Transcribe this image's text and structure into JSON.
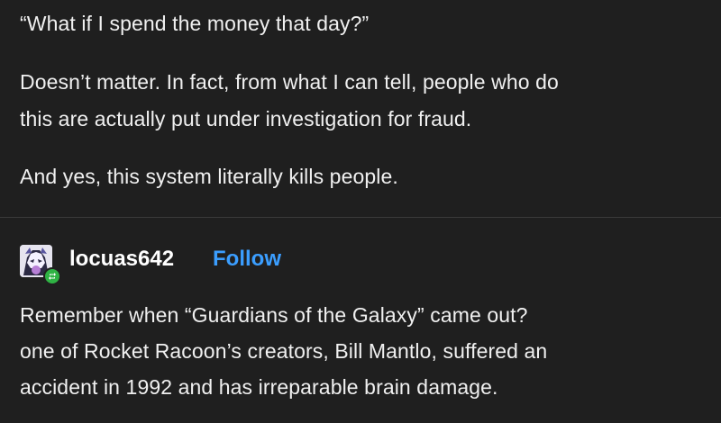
{
  "post_top": {
    "paragraphs": [
      "“What if I spend the money that day?”",
      "Doesn’t matter. In fact, from what I can tell, people who do",
      "this are actually put under investigation for fraud.",
      "And yes, this system literally kills people."
    ]
  },
  "reblog": {
    "username": "locuas642",
    "follow_label": "Follow",
    "avatar_icon": "avatar-icon",
    "badge_icon": "reblog-icon",
    "lines": [
      "Remember when “Guardians of the Galaxy” came out?",
      "one of Rocket Racoon’s creators, Bill Mantlo, suffered an",
      "accident in 1992 and has irreparable brain damage."
    ]
  },
  "colors": {
    "background": "#1f1f1f",
    "text": "#f0f0f0",
    "follow": "#3b9eff",
    "badge": "#2fb344"
  }
}
